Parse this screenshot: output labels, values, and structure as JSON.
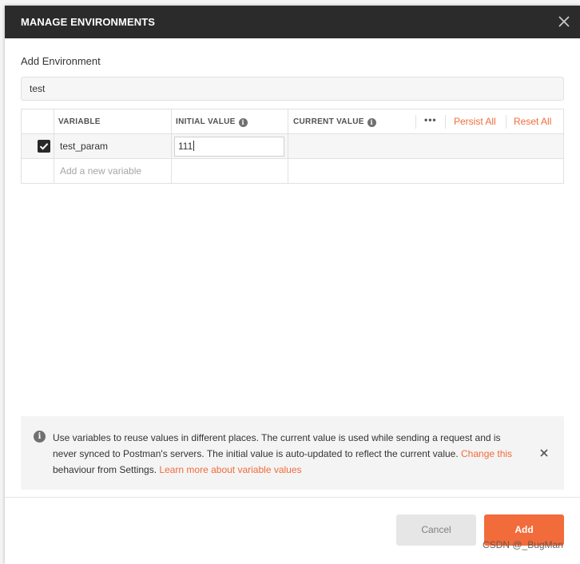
{
  "modal": {
    "title": "MANAGE ENVIRONMENTS"
  },
  "form": {
    "section_label": "Add Environment",
    "environment_name": "test"
  },
  "table": {
    "headers": {
      "variable": "VARIABLE",
      "initial_value": "INITIAL VALUE",
      "current_value": "CURRENT VALUE"
    },
    "actions": {
      "more": "•••",
      "persist_all": "Persist All",
      "reset_all": "Reset All"
    },
    "rows": [
      {
        "checked": true,
        "variable": "test_param",
        "initial_value": "111",
        "current_value": ""
      }
    ],
    "new_row_placeholder": "Add a new variable"
  },
  "info": {
    "text_1": "Use variables to reuse values in different places. The current value is used while sending a request and is never synced to Postman's servers. The initial value is auto-updated to reflect the current value. ",
    "link_change": "Change this",
    "text_2": " behaviour from Settings. ",
    "link_learn": "Learn more about variable values"
  },
  "buttons": {
    "cancel": "Cancel",
    "add": "Add"
  },
  "watermark": "CSDN @_BugMan",
  "colors": {
    "accent": "#f26b3a",
    "header_bg": "#2b2b2b"
  },
  "icons": {
    "close": "close-icon",
    "info": "info-icon",
    "checkbox": "checkmark-icon"
  }
}
